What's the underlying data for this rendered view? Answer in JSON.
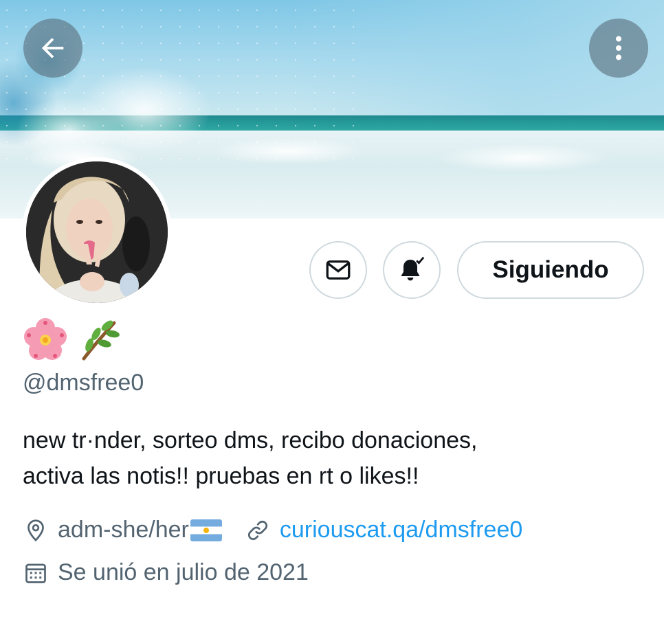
{
  "profile": {
    "display_name_emojis": [
      "cherry-blossom",
      "herb"
    ],
    "handle": "@dmsfree0",
    "bio_lines": [
      "new tr·nder, sorteo dms, recibo donaciones,",
      "activa las notis!! pruebas en rt o likes!!"
    ],
    "location": "adm-she/her",
    "location_flag": "argentina-flag",
    "website": "curiouscat.qa/dmsfree0",
    "joined": "Se unió en julio de 2021"
  },
  "actions": {
    "follow_label": "Siguiendo",
    "notifications_active": true
  },
  "icons": {
    "back": "arrow-left-icon",
    "more": "more-vertical-icon",
    "message": "envelope-icon",
    "notifications": "bell-check-icon",
    "location": "location-pin-icon",
    "link": "link-icon",
    "calendar": "calendar-icon"
  },
  "colors": {
    "text_primary": "#0f1419",
    "text_secondary": "#536471",
    "link": "#1d9bf0",
    "button_border": "#cfd9de"
  }
}
